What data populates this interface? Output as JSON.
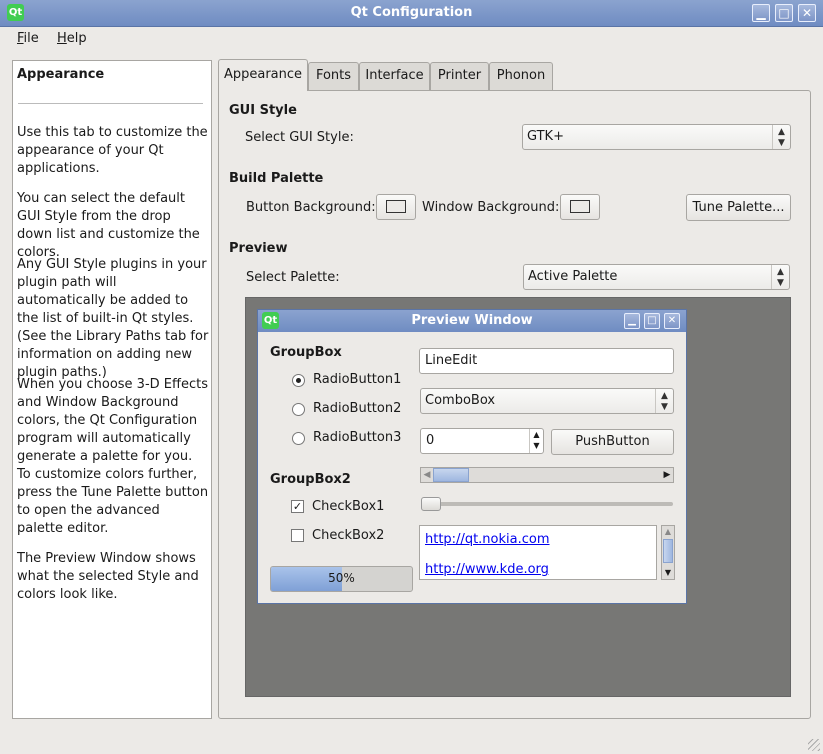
{
  "window": {
    "title": "Qt Configuration",
    "logo": "Qt",
    "controls": {
      "minimize": "▁",
      "maximize": "□",
      "close": "✕"
    }
  },
  "menu": {
    "file_key": "F",
    "file_rest": "ile",
    "help_key": "H",
    "help_rest": "elp"
  },
  "help": {
    "heading": "Appearance",
    "paragraphs": [
      "Use this tab to customize the appearance of your Qt applications.",
      "You can select the default GUI Style from the drop down list and customize the colors.",
      "Any GUI Style plugins in your plugin path will automatically be added to the list of built-in Qt styles. (See the Library Paths tab for information on adding new plugin paths.)",
      "When you choose 3-D Effects and Window Background colors, the Qt Configuration program will automatically generate a palette for you. To customize colors further, press the Tune Palette button to open the advanced palette editor.",
      "The Preview Window shows what the selected Style and colors look like."
    ]
  },
  "tabs": [
    "Appearance",
    "Fonts",
    "Interface",
    "Printer",
    "Phonon"
  ],
  "gui_style": {
    "section": "GUI Style",
    "label": "Select GUI Style:",
    "value": "GTK+"
  },
  "build_palette": {
    "section": "Build Palette",
    "button_bg_label": "Button Background:",
    "window_bg_label": "Window Background:",
    "tune_label": "Tune Palette..."
  },
  "preview": {
    "section": "Preview",
    "select_label": "Select Palette:",
    "palette_value": "Active Palette"
  },
  "preview_window": {
    "title": "Preview Window",
    "groupbox": "GroupBox",
    "radios": [
      "RadioButton1",
      "RadioButton2",
      "RadioButton3"
    ],
    "groupbox2": "GroupBox2",
    "checkboxes": [
      "CheckBox1",
      "CheckBox2"
    ],
    "checkbox1_checked": true,
    "progress_text": "50%",
    "progress_value": 0.5,
    "lineedit": "LineEdit",
    "combobox": "ComboBox",
    "spinbox": "0",
    "pushbutton": "PushButton",
    "links": [
      "http://qt.nokia.com",
      "http://www.kde.org"
    ]
  },
  "colors": {
    "titlebar": "#7b95c8",
    "preview_bg": "#777775",
    "progress_fill": "#8fb0e0",
    "link": "#0000ee"
  }
}
